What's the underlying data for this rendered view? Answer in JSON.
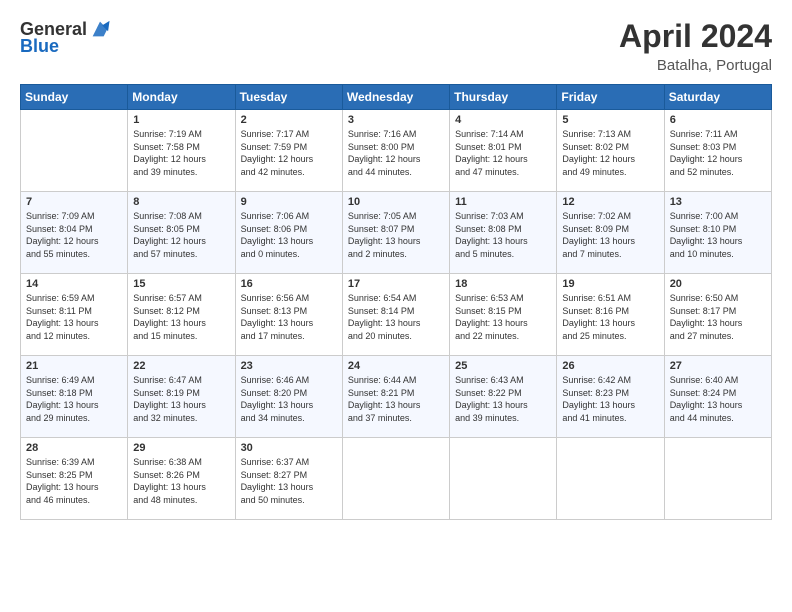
{
  "header": {
    "logo_general": "General",
    "logo_blue": "Blue",
    "month_title": "April 2024",
    "location": "Batalha, Portugal"
  },
  "weekdays": [
    "Sunday",
    "Monday",
    "Tuesday",
    "Wednesday",
    "Thursday",
    "Friday",
    "Saturday"
  ],
  "weeks": [
    [
      {
        "day": "",
        "text": ""
      },
      {
        "day": "1",
        "text": "Sunrise: 7:19 AM\nSunset: 7:58 PM\nDaylight: 12 hours\nand 39 minutes."
      },
      {
        "day": "2",
        "text": "Sunrise: 7:17 AM\nSunset: 7:59 PM\nDaylight: 12 hours\nand 42 minutes."
      },
      {
        "day": "3",
        "text": "Sunrise: 7:16 AM\nSunset: 8:00 PM\nDaylight: 12 hours\nand 44 minutes."
      },
      {
        "day": "4",
        "text": "Sunrise: 7:14 AM\nSunset: 8:01 PM\nDaylight: 12 hours\nand 47 minutes."
      },
      {
        "day": "5",
        "text": "Sunrise: 7:13 AM\nSunset: 8:02 PM\nDaylight: 12 hours\nand 49 minutes."
      },
      {
        "day": "6",
        "text": "Sunrise: 7:11 AM\nSunset: 8:03 PM\nDaylight: 12 hours\nand 52 minutes."
      }
    ],
    [
      {
        "day": "7",
        "text": "Sunrise: 7:09 AM\nSunset: 8:04 PM\nDaylight: 12 hours\nand 55 minutes."
      },
      {
        "day": "8",
        "text": "Sunrise: 7:08 AM\nSunset: 8:05 PM\nDaylight: 12 hours\nand 57 minutes."
      },
      {
        "day": "9",
        "text": "Sunrise: 7:06 AM\nSunset: 8:06 PM\nDaylight: 13 hours\nand 0 minutes."
      },
      {
        "day": "10",
        "text": "Sunrise: 7:05 AM\nSunset: 8:07 PM\nDaylight: 13 hours\nand 2 minutes."
      },
      {
        "day": "11",
        "text": "Sunrise: 7:03 AM\nSunset: 8:08 PM\nDaylight: 13 hours\nand 5 minutes."
      },
      {
        "day": "12",
        "text": "Sunrise: 7:02 AM\nSunset: 8:09 PM\nDaylight: 13 hours\nand 7 minutes."
      },
      {
        "day": "13",
        "text": "Sunrise: 7:00 AM\nSunset: 8:10 PM\nDaylight: 13 hours\nand 10 minutes."
      }
    ],
    [
      {
        "day": "14",
        "text": "Sunrise: 6:59 AM\nSunset: 8:11 PM\nDaylight: 13 hours\nand 12 minutes."
      },
      {
        "day": "15",
        "text": "Sunrise: 6:57 AM\nSunset: 8:12 PM\nDaylight: 13 hours\nand 15 minutes."
      },
      {
        "day": "16",
        "text": "Sunrise: 6:56 AM\nSunset: 8:13 PM\nDaylight: 13 hours\nand 17 minutes."
      },
      {
        "day": "17",
        "text": "Sunrise: 6:54 AM\nSunset: 8:14 PM\nDaylight: 13 hours\nand 20 minutes."
      },
      {
        "day": "18",
        "text": "Sunrise: 6:53 AM\nSunset: 8:15 PM\nDaylight: 13 hours\nand 22 minutes."
      },
      {
        "day": "19",
        "text": "Sunrise: 6:51 AM\nSunset: 8:16 PM\nDaylight: 13 hours\nand 25 minutes."
      },
      {
        "day": "20",
        "text": "Sunrise: 6:50 AM\nSunset: 8:17 PM\nDaylight: 13 hours\nand 27 minutes."
      }
    ],
    [
      {
        "day": "21",
        "text": "Sunrise: 6:49 AM\nSunset: 8:18 PM\nDaylight: 13 hours\nand 29 minutes."
      },
      {
        "day": "22",
        "text": "Sunrise: 6:47 AM\nSunset: 8:19 PM\nDaylight: 13 hours\nand 32 minutes."
      },
      {
        "day": "23",
        "text": "Sunrise: 6:46 AM\nSunset: 8:20 PM\nDaylight: 13 hours\nand 34 minutes."
      },
      {
        "day": "24",
        "text": "Sunrise: 6:44 AM\nSunset: 8:21 PM\nDaylight: 13 hours\nand 37 minutes."
      },
      {
        "day": "25",
        "text": "Sunrise: 6:43 AM\nSunset: 8:22 PM\nDaylight: 13 hours\nand 39 minutes."
      },
      {
        "day": "26",
        "text": "Sunrise: 6:42 AM\nSunset: 8:23 PM\nDaylight: 13 hours\nand 41 minutes."
      },
      {
        "day": "27",
        "text": "Sunrise: 6:40 AM\nSunset: 8:24 PM\nDaylight: 13 hours\nand 44 minutes."
      }
    ],
    [
      {
        "day": "28",
        "text": "Sunrise: 6:39 AM\nSunset: 8:25 PM\nDaylight: 13 hours\nand 46 minutes."
      },
      {
        "day": "29",
        "text": "Sunrise: 6:38 AM\nSunset: 8:26 PM\nDaylight: 13 hours\nand 48 minutes."
      },
      {
        "day": "30",
        "text": "Sunrise: 6:37 AM\nSunset: 8:27 PM\nDaylight: 13 hours\nand 50 minutes."
      },
      {
        "day": "",
        "text": ""
      },
      {
        "day": "",
        "text": ""
      },
      {
        "day": "",
        "text": ""
      },
      {
        "day": "",
        "text": ""
      }
    ]
  ]
}
